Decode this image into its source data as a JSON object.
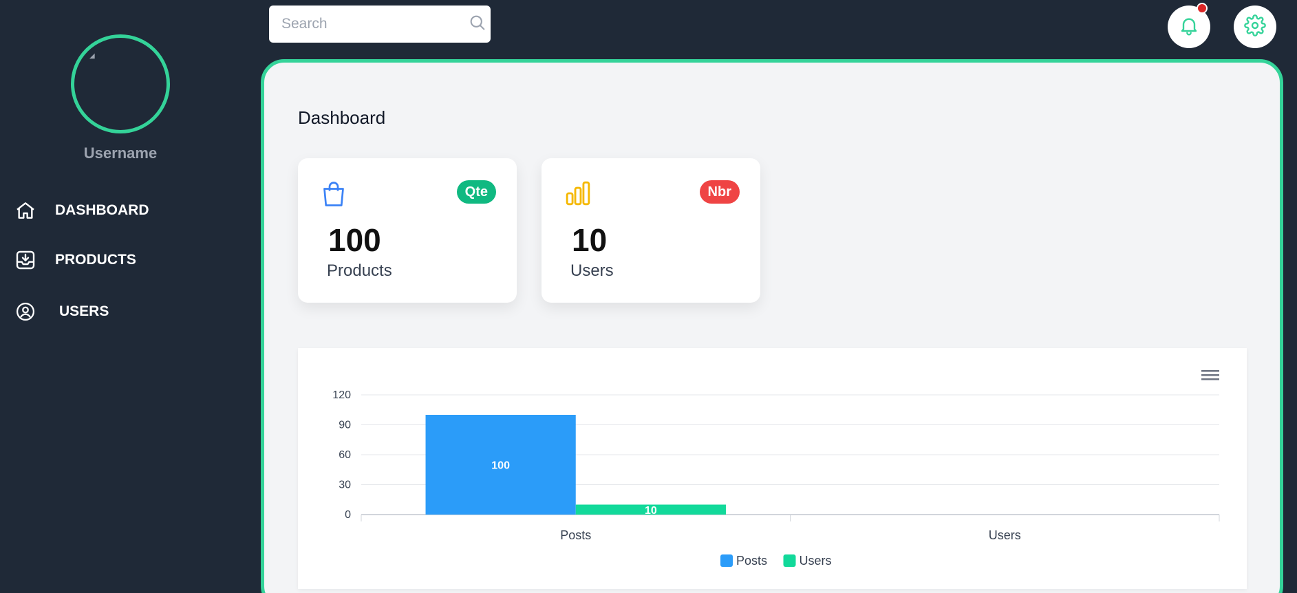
{
  "sidebar": {
    "username": "Username",
    "items": [
      {
        "label": "DASHBOARD",
        "icon": "home-icon"
      },
      {
        "label": "PRODUCTS",
        "icon": "inbox-download-icon"
      },
      {
        "label": "USERS",
        "icon": "user-circle-icon"
      }
    ]
  },
  "search": {
    "placeholder": "Search",
    "icon": "search-icon"
  },
  "header": {
    "notification_icon": "bell-icon",
    "settings_icon": "gear-icon"
  },
  "page": {
    "title": "Dashboard"
  },
  "cards": [
    {
      "badge": "Qte",
      "badge_color": "#10b981",
      "value": "100",
      "caption": "Products",
      "icon": "shopping-bag-icon",
      "icon_color": "#3b82f6"
    },
    {
      "badge": "Nbr",
      "badge_color": "#ef4444",
      "value": "10",
      "caption": "Users",
      "icon": "bar-chart-icon",
      "icon_color": "#f5b800"
    }
  ],
  "colors": {
    "accent": "#34d399",
    "sidebar_bg": "#1f2937",
    "posts": "#2b9cf9",
    "users": "#12d99a"
  },
  "chart_data": {
    "type": "bar",
    "categories": [
      "Posts",
      "Users"
    ],
    "series": [
      {
        "name": "Posts",
        "values": [
          100,
          null
        ],
        "color": "#2b9cf9"
      },
      {
        "name": "Users",
        "values": [
          10,
          null
        ],
        "color": "#12d99a"
      }
    ],
    "y_ticks": [
      "0",
      "30",
      "60",
      "90",
      "120"
    ],
    "ylim": [
      0,
      120
    ],
    "grid": true,
    "legend": "bottom-center",
    "data_labels": true
  }
}
